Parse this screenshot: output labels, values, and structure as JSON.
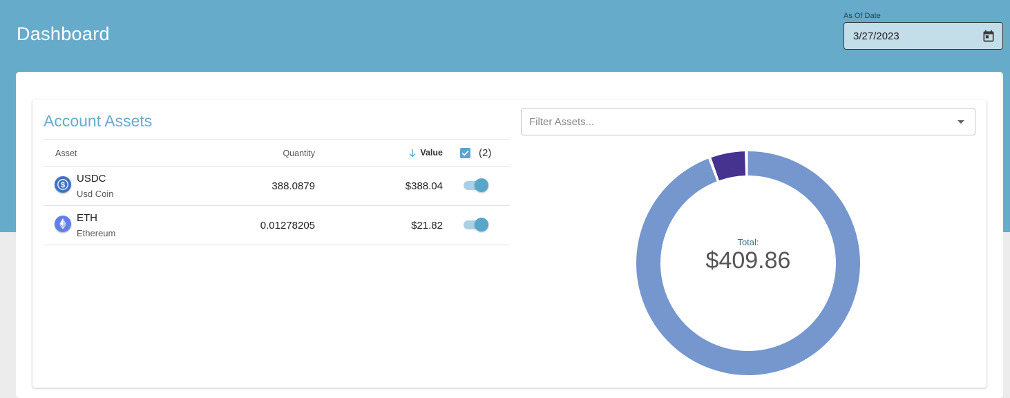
{
  "header": {
    "title": "Dashboard",
    "as_of_label": "As Of Date",
    "as_of_value": "3/27/2023",
    "calendar_icon": "calendar-icon"
  },
  "assets_panel": {
    "title": "Account Assets",
    "columns": {
      "asset": "Asset",
      "quantity": "Quantity",
      "value": "Value",
      "selected_count": "(2)"
    },
    "rows": [
      {
        "symbol": "USDC",
        "name": "Usd Coin",
        "quantity": "388.0879",
        "value": "$388.04",
        "enabled": true,
        "icon": "usdc-coin-icon",
        "color": "#3e73c4"
      },
      {
        "symbol": "ETH",
        "name": "Ethereum",
        "quantity": "0.01278205",
        "value": "$21.82",
        "enabled": true,
        "icon": "ethereum-coin-icon",
        "color": "#627eea"
      }
    ]
  },
  "filter": {
    "placeholder": "Filter Assets..."
  },
  "chart_data": {
    "type": "pie",
    "categories": [
      "USDC",
      "ETH"
    ],
    "values": [
      388.04,
      21.82
    ],
    "colors": [
      "#7597cd",
      "#46328f"
    ],
    "center_label": "Total:",
    "center_value": "$409.86",
    "title": ""
  },
  "colors": {
    "header_bg": "#67abcb",
    "accent": "#5aa6cb"
  }
}
